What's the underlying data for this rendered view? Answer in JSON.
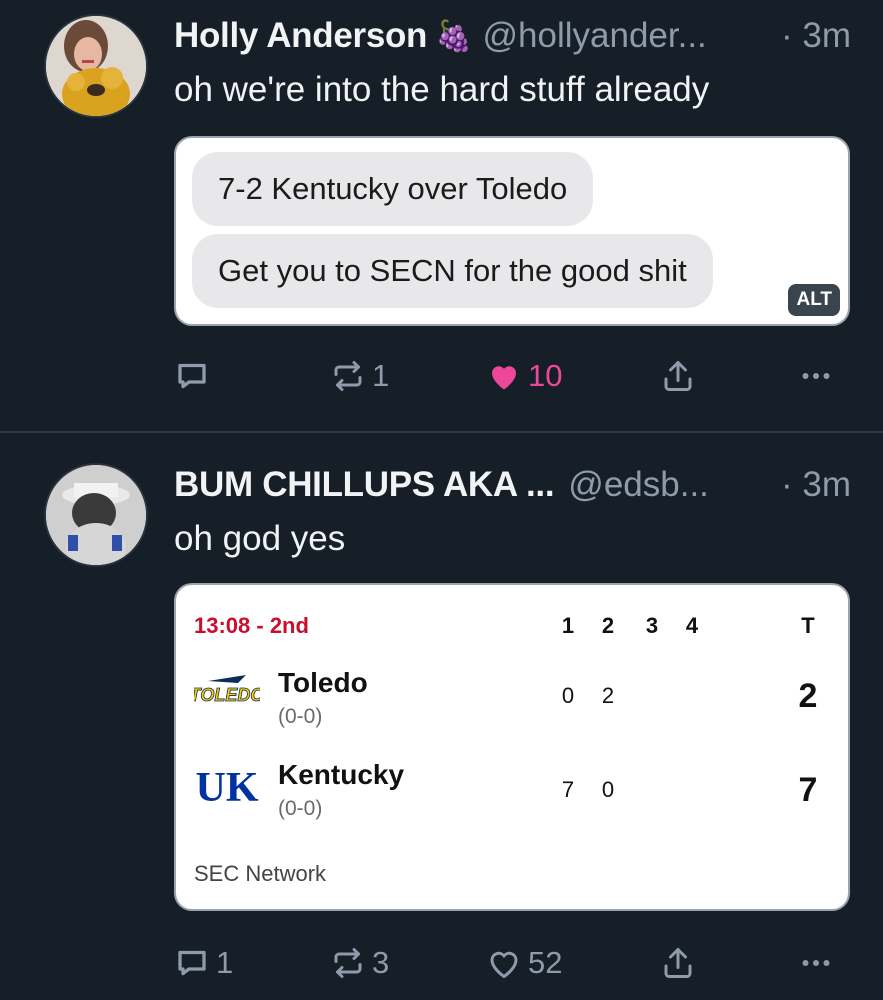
{
  "posts": [
    {
      "display_name": "Holly Anderson",
      "badge_emoji": "🍇",
      "handle": "@hollyander...",
      "time": "· 3m",
      "text": "oh we're into the hard stuff already",
      "embed": {
        "messages": [
          "7-2 Kentucky over Toledo",
          "Get you to SECN for the good shit"
        ],
        "alt_badge": "ALT"
      },
      "actions": {
        "replies": "",
        "reposts": "1",
        "likes": "10",
        "liked": true
      }
    },
    {
      "display_name": "BUM CHILLUPS AKA ...",
      "handle": "@edsb...",
      "time": "· 3m",
      "text": "oh god yes",
      "embed": {
        "clock": "13:08 - 2nd",
        "periods": [
          "1",
          "2",
          "3",
          "4"
        ],
        "total_label": "T",
        "teams": [
          {
            "name": "Toledo",
            "record": "(0-0)",
            "scores": [
              "0",
              "2"
            ],
            "total": "2"
          },
          {
            "name": "Kentucky",
            "record": "(0-0)",
            "scores": [
              "7",
              "0"
            ],
            "total": "7"
          }
        ],
        "network": "SEC Network"
      },
      "actions": {
        "replies": "1",
        "reposts": "3",
        "likes": "52",
        "liked": false
      }
    }
  ],
  "colors": {
    "background": "#161e27",
    "like_active": "#ec4899",
    "muted": "#8d9bab",
    "clock_red": "#c8102e",
    "kentucky_blue": "#0033a0",
    "toledo_gold": "#ffcc00"
  },
  "icons": [
    "reply-icon",
    "repost-icon",
    "heart-icon",
    "share-icon",
    "more-icon"
  ]
}
